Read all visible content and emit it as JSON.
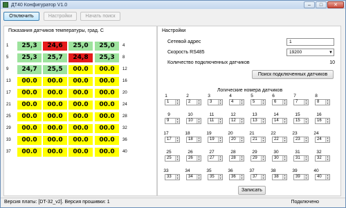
{
  "window": {
    "title": "ДТ40 Конфигуратор V1.0",
    "minimize_glyph": "–",
    "maximize_glyph": "□",
    "close_glyph": "✕"
  },
  "toolbar": {
    "disconnect_label": "Отключить",
    "settings_label": "Настройки",
    "start_search_label": "Начать поиск"
  },
  "sensors": {
    "title": "Показания датчиков температуры,  град. С",
    "colors": {
      "green": "#9de39d",
      "red": "#e51b1b",
      "yellow": "#ffff00"
    },
    "rows": [
      {
        "left": "1",
        "right": "4",
        "cells": [
          {
            "v": "25,3",
            "c": "green"
          },
          {
            "v": "24,6",
            "c": "red"
          },
          {
            "v": "25,0",
            "c": "green"
          },
          {
            "v": "25,0",
            "c": "green"
          }
        ]
      },
      {
        "left": "5",
        "right": "8",
        "cells": [
          {
            "v": "25,3",
            "c": "green"
          },
          {
            "v": "25,7",
            "c": "green"
          },
          {
            "v": "24,8",
            "c": "red"
          },
          {
            "v": "25,3",
            "c": "green"
          }
        ]
      },
      {
        "left": "9",
        "right": "12",
        "cells": [
          {
            "v": "24,7",
            "c": "green"
          },
          {
            "v": "25,5",
            "c": "green"
          },
          {
            "v": "00.0",
            "c": "yellow"
          },
          {
            "v": "00.0",
            "c": "yellow"
          }
        ]
      },
      {
        "left": "13",
        "right": "16",
        "cells": [
          {
            "v": "00.0",
            "c": "yellow"
          },
          {
            "v": "00.0",
            "c": "yellow"
          },
          {
            "v": "00.0",
            "c": "yellow"
          },
          {
            "v": "00.0",
            "c": "yellow"
          }
        ]
      },
      {
        "left": "17",
        "right": "20",
        "cells": [
          {
            "v": "00.0",
            "c": "yellow"
          },
          {
            "v": "00.0",
            "c": "yellow"
          },
          {
            "v": "00.0",
            "c": "yellow"
          },
          {
            "v": "00.0",
            "c": "yellow"
          }
        ]
      },
      {
        "left": "21",
        "right": "24",
        "cells": [
          {
            "v": "00.0",
            "c": "yellow"
          },
          {
            "v": "00.0",
            "c": "yellow"
          },
          {
            "v": "00.0",
            "c": "yellow"
          },
          {
            "v": "00.0",
            "c": "yellow"
          }
        ]
      },
      {
        "left": "25",
        "right": "28",
        "cells": [
          {
            "v": "00.0",
            "c": "yellow"
          },
          {
            "v": "00.0",
            "c": "yellow"
          },
          {
            "v": "00.0",
            "c": "yellow"
          },
          {
            "v": "00.0",
            "c": "yellow"
          }
        ]
      },
      {
        "left": "29",
        "right": "32",
        "cells": [
          {
            "v": "00.0",
            "c": "yellow"
          },
          {
            "v": "00.0",
            "c": "yellow"
          },
          {
            "v": "00.0",
            "c": "yellow"
          },
          {
            "v": "00.0",
            "c": "yellow"
          }
        ]
      },
      {
        "left": "33",
        "right": "36",
        "cells": [
          {
            "v": "00.0",
            "c": "yellow"
          },
          {
            "v": "00.0",
            "c": "yellow"
          },
          {
            "v": "00.0",
            "c": "yellow"
          },
          {
            "v": "00.0",
            "c": "yellow"
          }
        ]
      },
      {
        "left": "37",
        "right": "40",
        "cells": [
          {
            "v": "00.0",
            "c": "yellow"
          },
          {
            "v": "00.0",
            "c": "yellow"
          },
          {
            "v": "00.0",
            "c": "yellow"
          },
          {
            "v": "00.0",
            "c": "yellow"
          }
        ]
      }
    ]
  },
  "settings": {
    "title": "Настройки",
    "network_address_label": "Сетевой адрес",
    "network_address_value": "1",
    "baud_label": "Скорость RS485",
    "baud_value": "19200",
    "connected_count_label": "Количество подключенных датчиков",
    "connected_count_value": "10",
    "search_button_label": "Поиск подключенных датчиков",
    "logical_title": "Логические номера датчиков",
    "logical_numbers": [
      "1",
      "2",
      "3",
      "4",
      "5",
      "6",
      "7",
      "8",
      "9",
      "10",
      "11",
      "12",
      "13",
      "14",
      "15",
      "16",
      "17",
      "18",
      "19",
      "20",
      "21",
      "22",
      "23",
      "24",
      "25",
      "26",
      "27",
      "28",
      "29",
      "30",
      "31",
      "32",
      "33",
      "34",
      "35",
      "36",
      "37",
      "38",
      "39",
      "40"
    ],
    "logical_values": [
      "1",
      "2",
      "3",
      "4",
      "5",
      "6",
      "7",
      "8",
      "9",
      "10",
      "11",
      "12",
      "13",
      "14",
      "15",
      "16",
      "17",
      "18",
      "19",
      "20",
      "21",
      "22",
      "23",
      "24",
      "25",
      "26",
      "27",
      "28",
      "29",
      "30",
      "31",
      "32",
      "33",
      "34",
      "35",
      "36",
      "37",
      "38",
      "39",
      "40"
    ],
    "write_button_label": "Записать"
  },
  "statusbar": {
    "left": "Версия платы: [DT-32_v2]. Версия прошивки: 1",
    "right": "Подключено"
  }
}
